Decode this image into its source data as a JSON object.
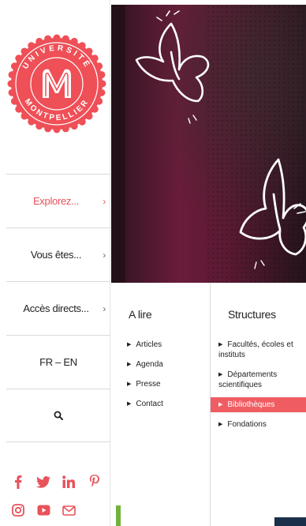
{
  "brand": {
    "ring_top": "UNIVERSITÉ",
    "ring_bottom": "MONTPELLIER",
    "color": "#ef4f57"
  },
  "nav": {
    "items": [
      {
        "label": "Explorez...",
        "active": true
      },
      {
        "label": "Vous êtes...",
        "active": false
      },
      {
        "label": "Accès directs...",
        "active": false
      },
      {
        "label": "FR – EN",
        "active": false
      }
    ],
    "chevron": "›",
    "search_icon": "search-icon"
  },
  "socials": {
    "row1": [
      "facebook-icon",
      "twitter-icon",
      "linkedin-icon",
      "pinterest-icon"
    ],
    "row2": [
      "instagram-icon",
      "youtube-icon",
      "mail-icon"
    ]
  },
  "menu": {
    "left": {
      "title": "A lire",
      "links": [
        "Articles",
        "Agenda",
        "Presse",
        "Contact"
      ]
    },
    "right": {
      "title": "Structures",
      "links": [
        "Facultés, écoles et instituts",
        "Départements scientifiques",
        "Bibliothèques",
        "Fondations"
      ],
      "highlighted_index": 2
    },
    "bullet": "▶"
  },
  "colors": {
    "accent": "#e8525a",
    "highlight": "#ef5d63",
    "hero_bg": "#3a1a27"
  }
}
